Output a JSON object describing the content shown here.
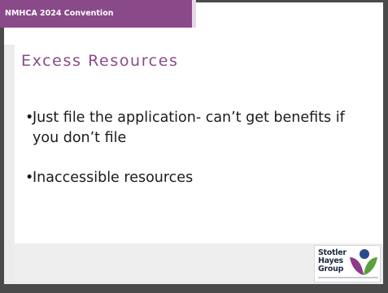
{
  "header": {
    "convention_label": "NMHCA 2024 Convention"
  },
  "slide": {
    "title": "Excess Resources",
    "bullets": [
      {
        "marker": "•",
        "text": "Just file the application- can’t get benefits if you don’t file"
      },
      {
        "marker": "•",
        "text": "Inaccessible resources"
      }
    ]
  },
  "logo": {
    "line1": "Stotler",
    "line2": "Hayes",
    "line3": "Group",
    "colors": {
      "purple": "#8e3a8a",
      "blue": "#2a4a8c",
      "green": "#5aa13a"
    }
  },
  "theme": {
    "accent": "#8a4a8a",
    "frame": "#4a4a4a",
    "text": "#1a1a1a"
  }
}
